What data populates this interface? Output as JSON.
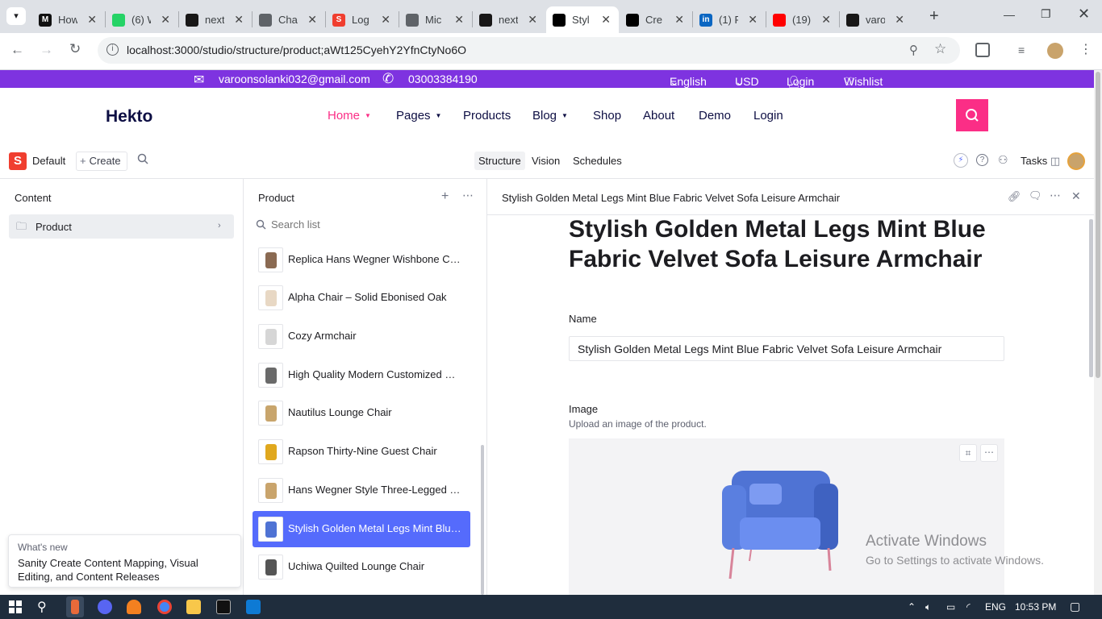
{
  "browser": {
    "tabs": [
      {
        "title": "How",
        "favicon": "M",
        "color": "#111111"
      },
      {
        "title": "(6) W",
        "favicon": "whatsapp",
        "color": "#25d366"
      },
      {
        "title": "next",
        "favicon": "github",
        "color": "#181717"
      },
      {
        "title": "Cha",
        "favicon": "openai",
        "color": "#5f6368"
      },
      {
        "title": "Log",
        "favicon": "S",
        "color": "#f03e2f"
      },
      {
        "title": "Mic",
        "favicon": "globe",
        "color": "#5f6368"
      },
      {
        "title": "next",
        "favicon": "github",
        "color": "#181717"
      },
      {
        "title": "Styl",
        "favicon": "vercel",
        "color": "#000000"
      },
      {
        "title": "Cre",
        "favicon": "vercel",
        "color": "#000000"
      },
      {
        "title": "(1) F",
        "favicon": "in",
        "color": "#0a66c2"
      },
      {
        "title": "(19)",
        "favicon": "youtube",
        "color": "#ff0000"
      },
      {
        "title": "varo",
        "favicon": "github",
        "color": "#181717"
      }
    ],
    "url": "localhost:3000/studio/structure/product;aWt125CyehY2YfnCtyNo6O"
  },
  "hekto": {
    "email": "varoonsolanki032@gmail.com",
    "phone": "03003384190",
    "language": "English",
    "currency": "USD",
    "login": "Login",
    "wishlist": "Wishlist",
    "logo": "Hekto",
    "nav": {
      "home": "Home",
      "pages": "Pages",
      "products": "Products",
      "blog": "Blog",
      "shop": "Shop",
      "about": "About",
      "demo": "Demo",
      "login": "Login"
    },
    "accent": "#fb2e86",
    "topbar_color": "#7e33e0"
  },
  "studio": {
    "workspace": "Default",
    "create": "Create",
    "tabs": {
      "structure": "Structure",
      "vision": "Vision",
      "schedules": "Schedules"
    },
    "tasks": "Tasks",
    "content_pane": {
      "title": "Content",
      "item": "Product"
    },
    "product_pane": {
      "title": "Product",
      "search_placeholder": "Search list",
      "items": [
        {
          "label": "Replica Hans Wegner Wishbone Chair"
        },
        {
          "label": "Alpha Chair – Solid Ebonised Oak"
        },
        {
          "label": "Cozy Armchair"
        },
        {
          "label": "High Quality Modern Customized Pl..."
        },
        {
          "label": "Nautilus Lounge Chair"
        },
        {
          "label": "Rapson Thirty-Nine Guest Chair"
        },
        {
          "label": "Hans Wegner Style Three-Legged Sh..."
        },
        {
          "label": "Stylish Golden Metal Legs Mint Blue..."
        },
        {
          "label": "Uchiwa Quilted Lounge Chair"
        }
      ]
    },
    "document": {
      "header": "Stylish Golden Metal Legs Mint Blue Fabric Velvet Sofa Leisure Armchair",
      "title": "Stylish Golden Metal Legs Mint Blue Fabric Velvet Sofa Leisure Armchair",
      "name_label": "Name",
      "name_value": "Stylish Golden Metal Legs Mint Blue Fabric Velvet Sofa Leisure Armchair",
      "image_label": "Image",
      "image_desc": "Upload an image of the product."
    },
    "whats_new": {
      "label": "What's new",
      "text": "Sanity Create Content Mapping, Visual Editing, and Content Releases"
    },
    "selected_color": "#556bfc"
  },
  "watermark": {
    "line1": "Activate Windows",
    "line2": "Go to Settings to activate Windows."
  },
  "taskbar": {
    "lang": "ENG",
    "time": "10:53 PM"
  }
}
